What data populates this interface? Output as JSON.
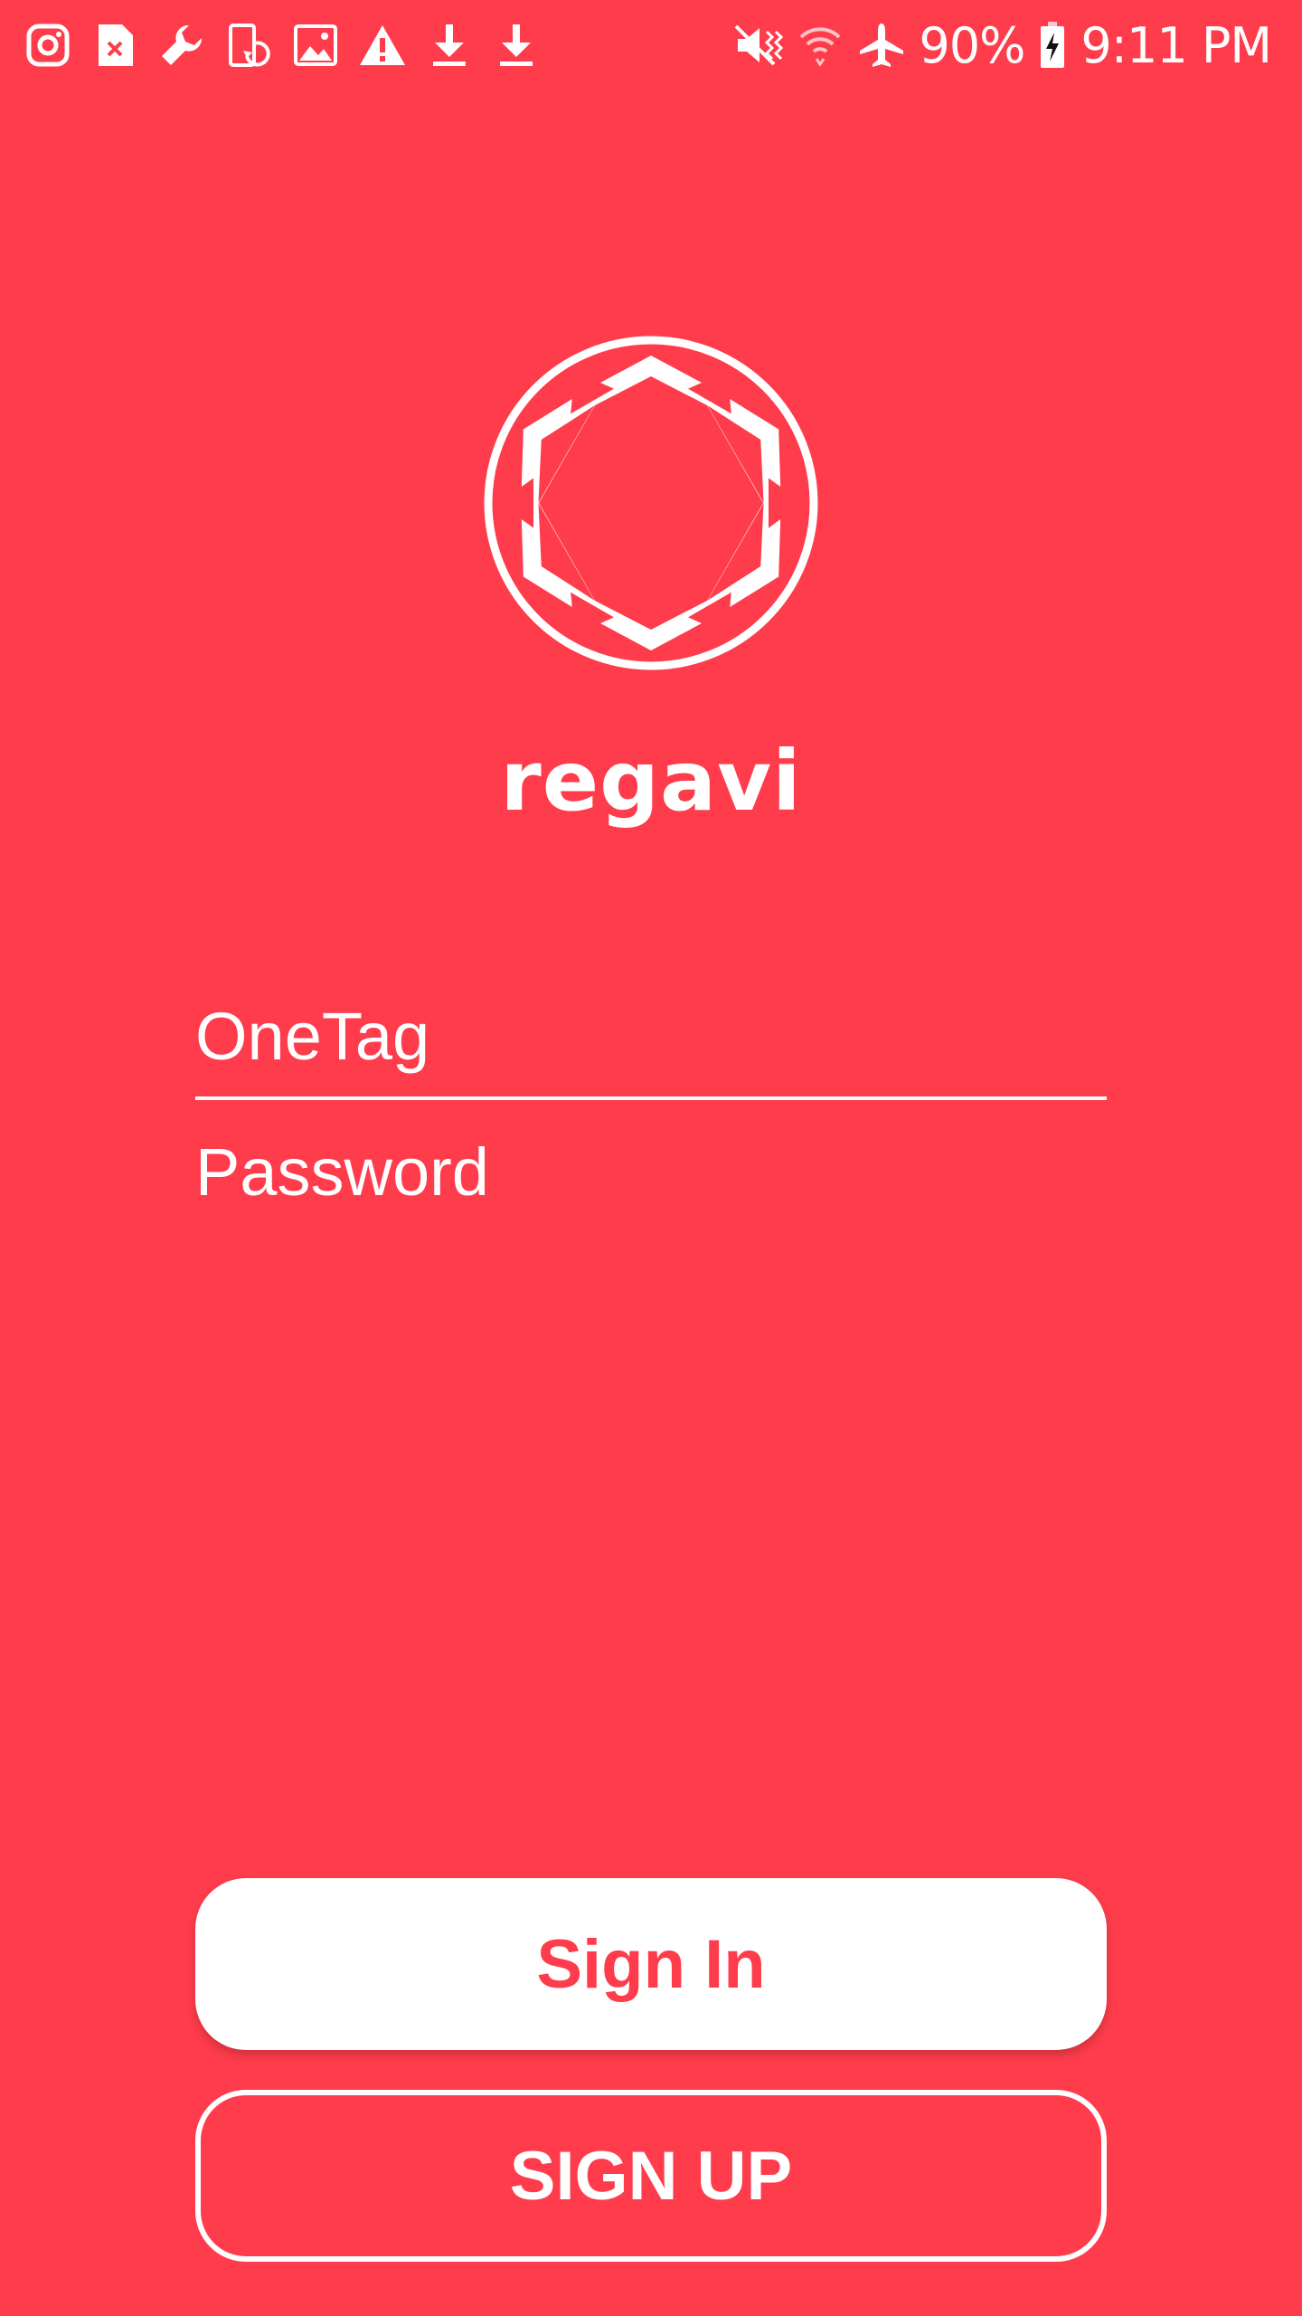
{
  "status_bar": {
    "left_icons": [
      "instagram-icon",
      "sim-error-icon",
      "wrench-icon",
      "screen-rotate-icon",
      "image-icon",
      "warning-icon",
      "download-icon",
      "download-icon"
    ],
    "right_icons": [
      "vibrate-mute-icon",
      "wifi-icon",
      "airplane-icon",
      "battery-charging-icon"
    ],
    "battery": "90%",
    "time": "9:11 PM"
  },
  "app": {
    "name": "regavi",
    "logo_icon": "regavi-logo-icon"
  },
  "form": {
    "onetag_placeholder": "OneTag",
    "password_placeholder": "Password"
  },
  "buttons": {
    "signin_label": "Sign In",
    "signup_label": "SIGN UP"
  },
  "colors": {
    "background": "#ff3c4b",
    "foreground": "#ffffff"
  }
}
